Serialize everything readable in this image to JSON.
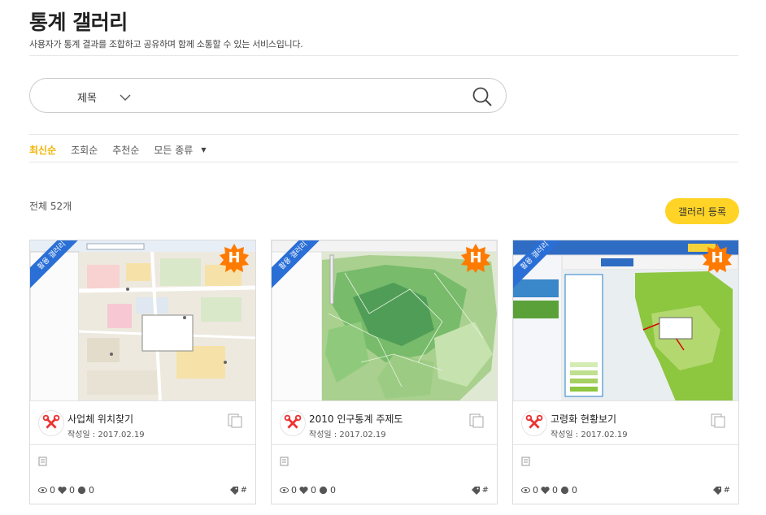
{
  "header": {
    "title": "통계 갤러리",
    "description": "사용자가 통계 결과를 조합하고 공유하며 함께 소통할 수 있는 서비스입니다."
  },
  "search": {
    "field_label": "제목",
    "search_icon": "search-icon"
  },
  "sort": {
    "items": [
      "최신순",
      "조회순",
      "추천순"
    ],
    "active": "최신순",
    "type_filter": "모든 종류"
  },
  "summary": {
    "total_label": "전체 52개"
  },
  "register_button": "갤러리 등록",
  "colors": {
    "accent": "#f0b400",
    "button_yellow": "#ffd426",
    "ribbon_blue": "#2a6fd6",
    "badge_orange": "#ff7a00"
  },
  "cards": [
    {
      "title": "사업체 위치찾기",
      "date": "작성일 : 2017.02.19",
      "ribbon": "활용 갤러리",
      "badge": "H",
      "views": "0",
      "likes": "0",
      "comments": "0",
      "tag": "#"
    },
    {
      "title": "2010 인구통계 주제도",
      "date": "작성일 : 2017.02.19",
      "ribbon": "활용 갤러리",
      "badge": "H",
      "views": "0",
      "likes": "0",
      "comments": "0",
      "tag": "#"
    },
    {
      "title": "고령화 현황보기",
      "date": "작성일 : 2017.02.19",
      "ribbon": "활용 갤러리",
      "badge": "H",
      "views": "0",
      "likes": "0",
      "comments": "0",
      "tag": "#"
    }
  ]
}
